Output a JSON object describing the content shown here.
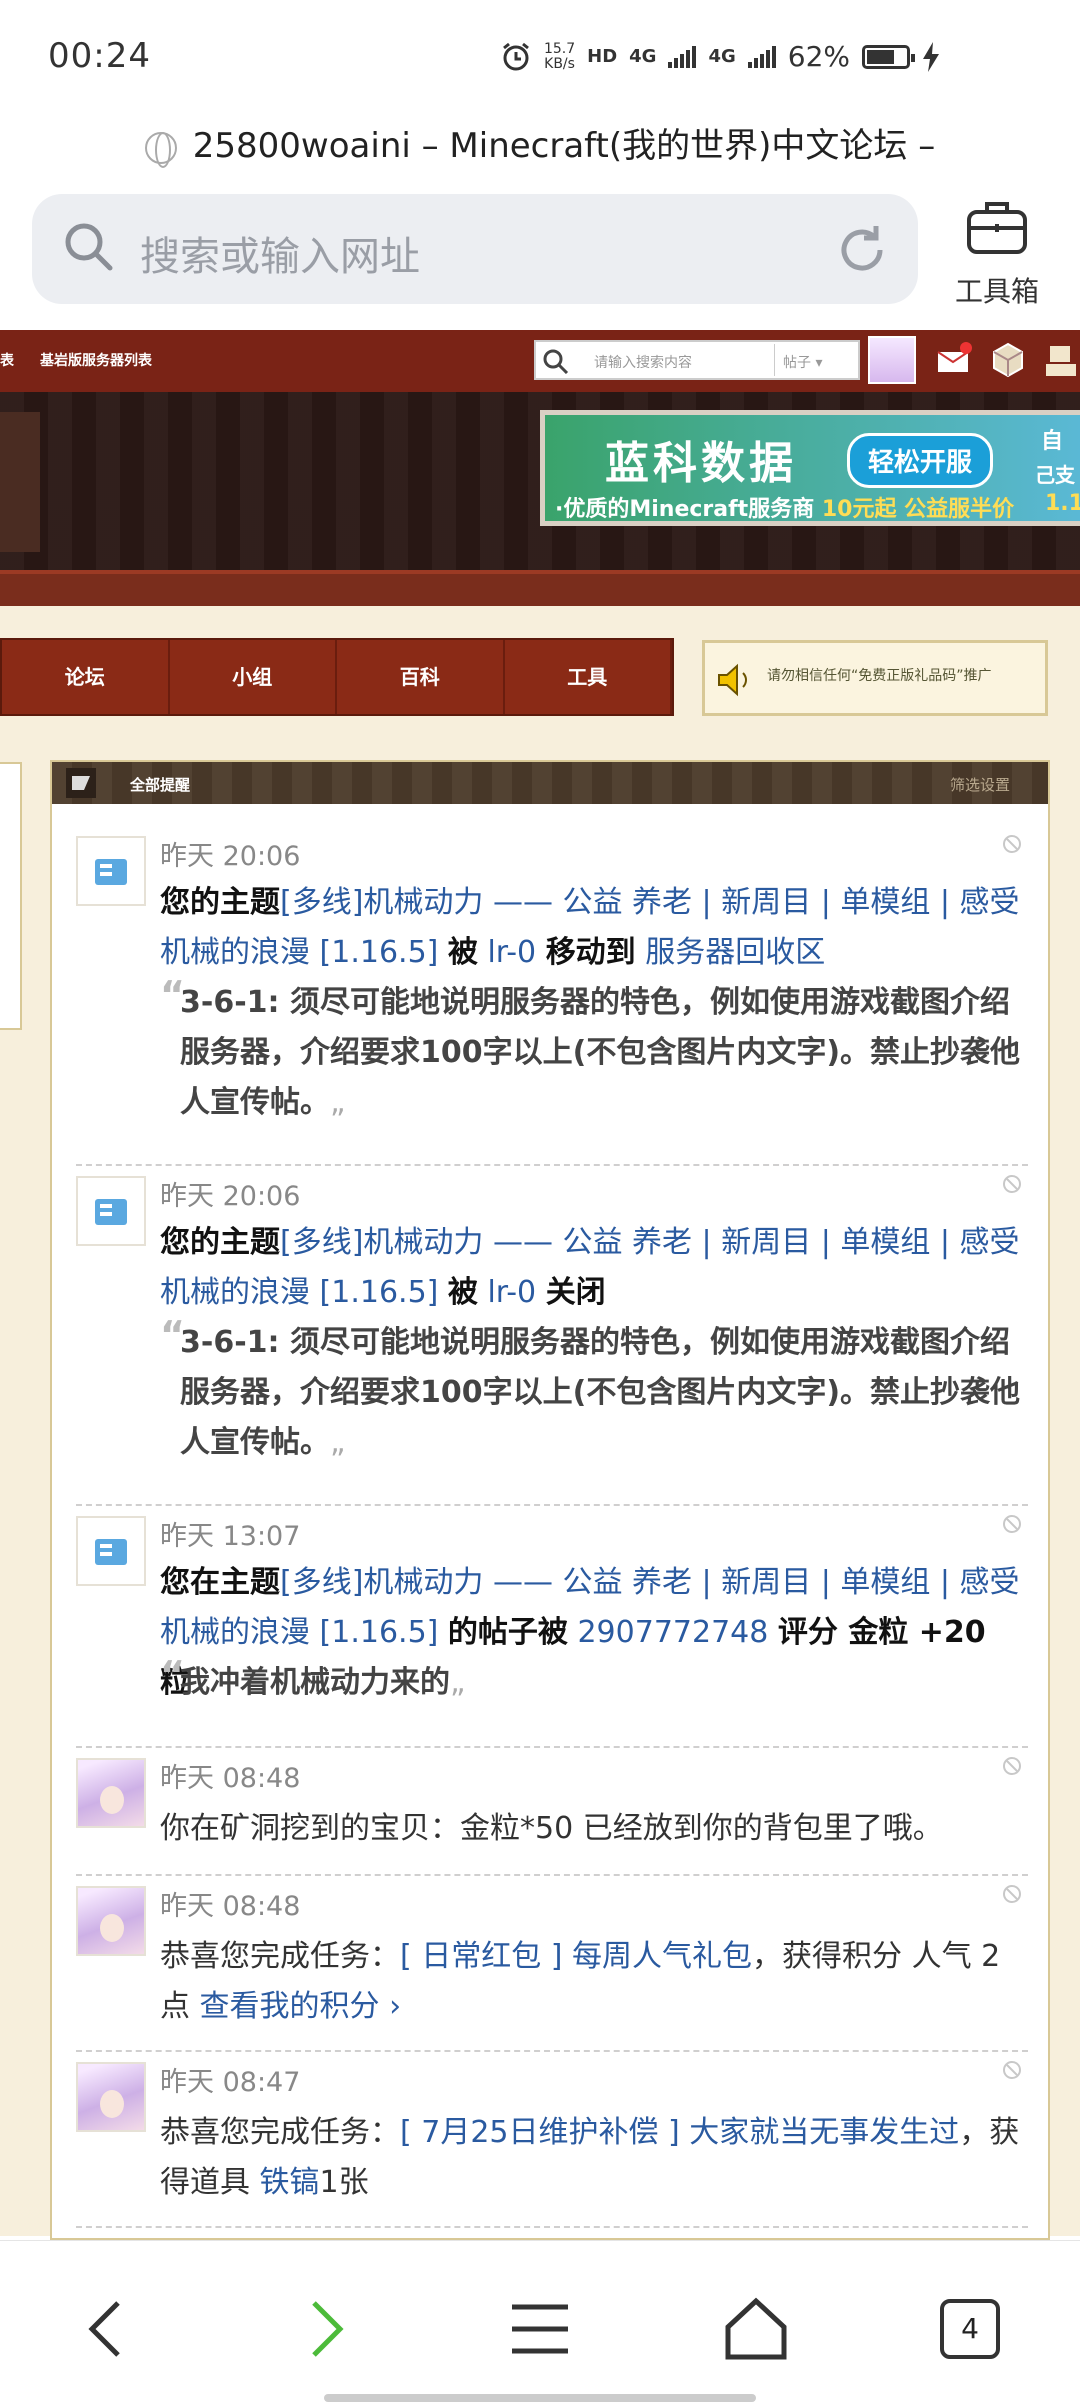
{
  "status": {
    "time": "00:24",
    "speed_top": "15.7",
    "speed_unit": "KB/s",
    "hd": "HD",
    "net1": "4G",
    "net2": "4G",
    "battery": "62%"
  },
  "browser": {
    "page_title": "25800woaini – Minecraft(我的世界)中文论坛 –",
    "search_placeholder": "搜索或输入网址",
    "toolbox_label": "工具箱"
  },
  "forum_header": {
    "links": [
      "表",
      "基岩版服务器列表"
    ],
    "search_placeholder": "请输入搜索内容",
    "search_type": "帖子",
    "ad": {
      "title": "蓝科数据",
      "button": "轻松开服",
      "sub_a": "·优质的Minecraft服务商",
      "sub_b": "10元起 公益服半价",
      "edge_a": "自",
      "edge_b": "己支",
      "edge_c": "1.1"
    }
  },
  "nav": {
    "items": [
      "论坛",
      "小组",
      "百科",
      "工具"
    ],
    "notice": "请勿相信任何“免费正版礼品码”推广"
  },
  "panel": {
    "title": "全部提醒",
    "settings": "筛选设置"
  },
  "notifications": [
    {
      "time": "昨天 20:06",
      "prefix": "您的主题",
      "topic": "[多线]机械动力 —— 公益 养老 | 新周目 | 单模组 | 感受机械的浪漫 [1.16.5]",
      "mid": "被",
      "user": "lr-0",
      "action": "移动到",
      "target": "服务器回收区",
      "quote": "3-6-1: 须尽可能地说明服务器的特色，例如使用游戏截图介绍服务器，介绍要求100字以上(不包含图片内文字)。禁止抄袭他人宣传帖。"
    },
    {
      "time": "昨天 20:06",
      "prefix": "您的主题",
      "topic": "[多线]机械动力 —— 公益 养老 | 新周目 | 单模组 | 感受机械的浪漫 [1.16.5]",
      "mid": "被",
      "user": "lr-0",
      "action": "关闭",
      "quote": "3-6-1: 须尽可能地说明服务器的特色，例如使用游戏截图介绍服务器，介绍要求100字以上(不包含图片内文字)。禁止抄袭他人宣传帖。"
    },
    {
      "time": "昨天 13:07",
      "prefix": "您在主题",
      "topic": "[多线]机械动力 —— 公益 养老 | 新周目 | 单模组 | 感受机械的浪漫 [1.16.5]",
      "mid": "的帖子被",
      "user": "2907772748",
      "action": "评分 金粒 +20 粒",
      "quote": "我冲着机械动力来的"
    },
    {
      "time": "昨天 08:48",
      "text": "你在矿洞挖到的宝贝：金粒*50 已经放到你的背包里了哦。"
    },
    {
      "time": "昨天 08:48",
      "text_a": "恭喜您完成任务：",
      "task": "[ 日常红包 ] 每周人气礼包",
      "text_b": "，获得积分 人气 2 点",
      "link": "查看我的积分 ›"
    },
    {
      "time": "昨天 08:47",
      "text_a": "恭喜您完成任务：",
      "task": "[ 7月25日维护补偿 ] 大家就当无事发生过",
      "text_b": "，获得道具",
      "item": "铁镐",
      "text_c": "1张"
    }
  ],
  "bottom": {
    "tabs_count": "4"
  },
  "colors": {
    "forum_red": "#7a2316",
    "link": "#2a5aa0",
    "cream": "#f7efdc"
  }
}
